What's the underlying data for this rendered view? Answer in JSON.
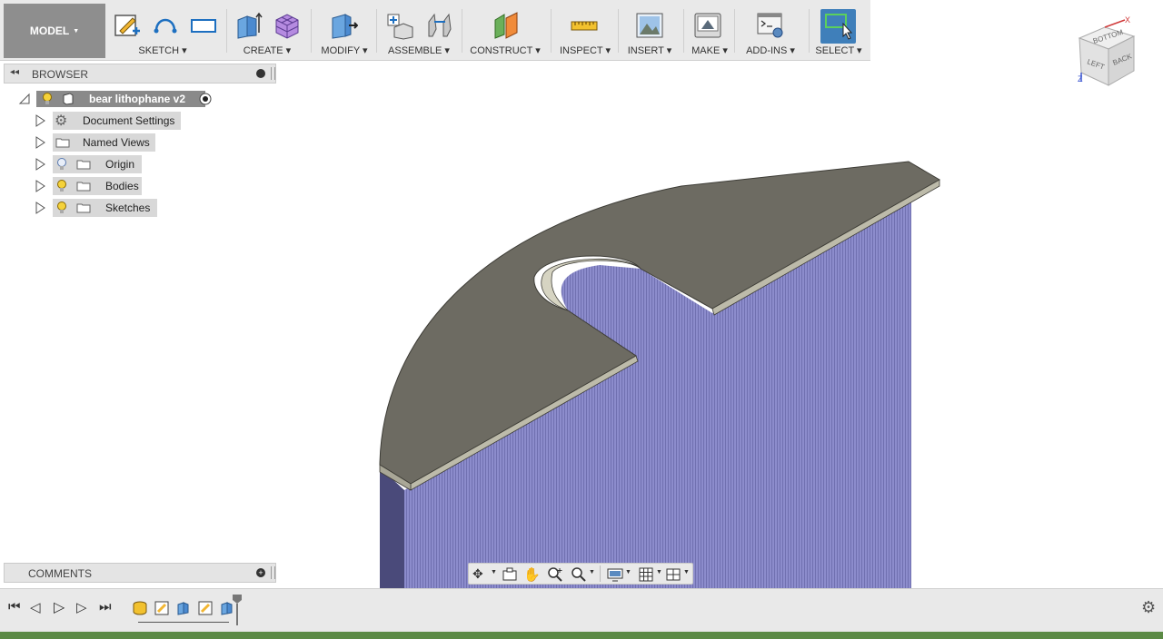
{
  "toolbar": {
    "model_label": "MODEL",
    "groups": [
      {
        "label": "SKETCH"
      },
      {
        "label": "CREATE"
      },
      {
        "label": "MODIFY"
      },
      {
        "label": "ASSEMBLE"
      },
      {
        "label": "CONSTRUCT"
      },
      {
        "label": "INSPECT"
      },
      {
        "label": "INSERT"
      },
      {
        "label": "MAKE"
      },
      {
        "label": "ADD-INS"
      },
      {
        "label": "SELECT"
      }
    ]
  },
  "browser": {
    "title": "BROWSER",
    "root": {
      "label": "bear lithophane v2"
    },
    "items": [
      {
        "label": "Document Settings",
        "icon": "gear-icon"
      },
      {
        "label": "Named Views",
        "icon": "folder-icon"
      },
      {
        "label": "Origin",
        "icon": "folder-icon",
        "visibility": "bulb-off"
      },
      {
        "label": "Bodies",
        "icon": "folder-icon",
        "visibility": "bulb-on"
      },
      {
        "label": "Sketches",
        "icon": "folder-icon",
        "visibility": "bulb-on"
      }
    ]
  },
  "comments": {
    "title": "COMMENTS"
  },
  "viewcube": {
    "top": "BOTTOM",
    "left": "LEFT",
    "back": "BACK",
    "axis_x": "X",
    "axis_z": "Z"
  },
  "colors": {
    "accent": "#3b6fa8",
    "body_surface": "#6d6b62",
    "lithophane": "#8a8ac8",
    "select_active": "#3f7fba"
  }
}
